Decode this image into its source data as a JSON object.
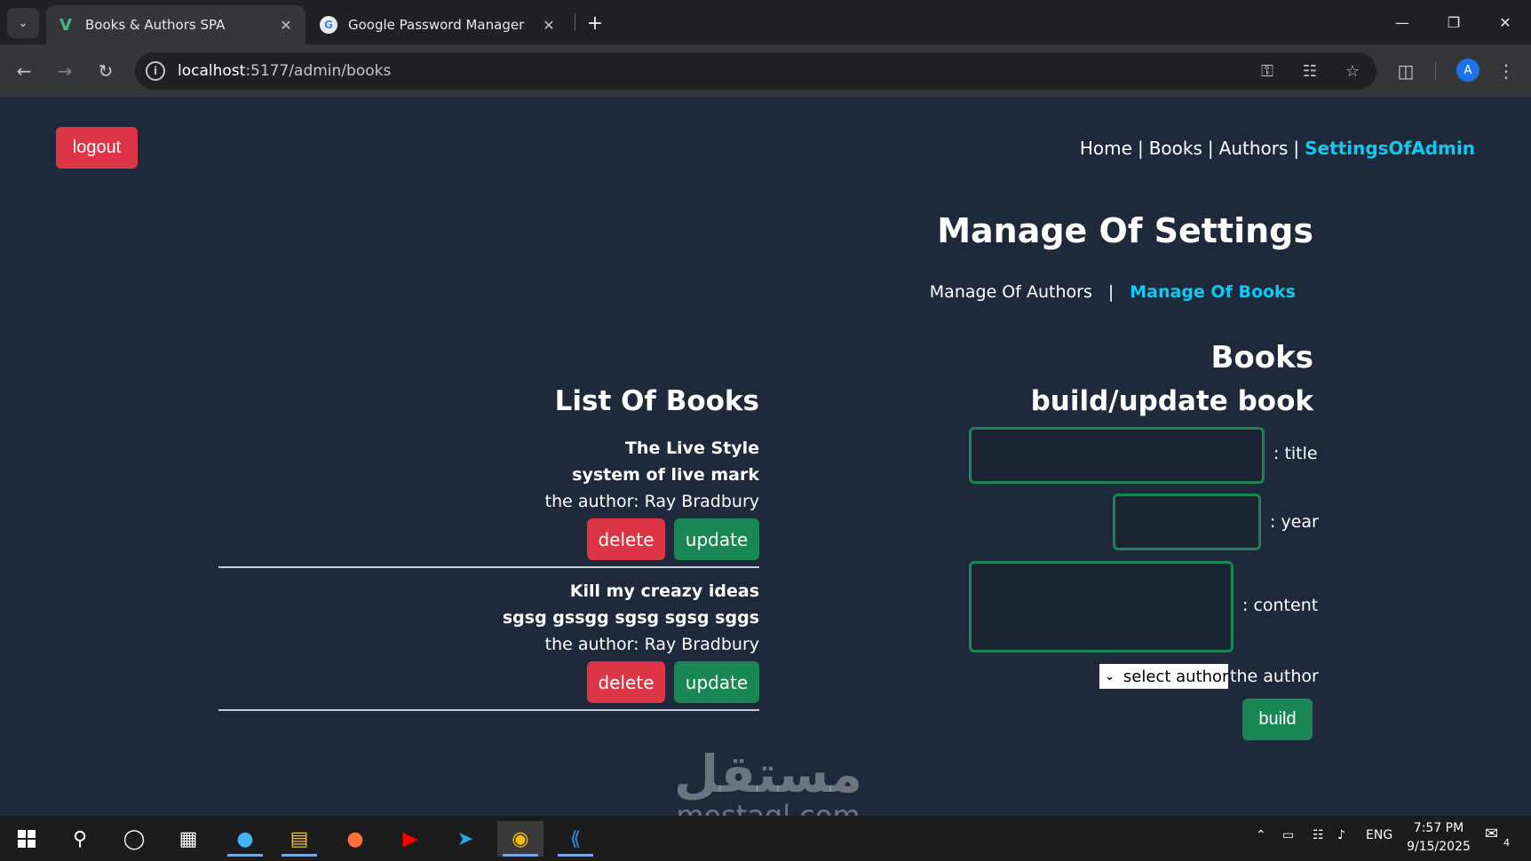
{
  "browser": {
    "tabs": [
      {
        "title": "Books & Authors SPA",
        "active": true
      },
      {
        "title": "Google Password Manager",
        "active": false
      }
    ],
    "url_host": "localhost",
    "url_rest": ":5177/admin/books",
    "avatar_letter": "A"
  },
  "page": {
    "logout_label": "logout",
    "nav": {
      "home": "Home",
      "books": "Books",
      "authors": "Authors",
      "settings": "SettingsOfAdmin",
      "separator": "|"
    },
    "settings_title": "Manage Of Settings",
    "subnav": {
      "authors": "Manage Of Authors",
      "separator": "|",
      "books": "Manage Of Books"
    },
    "books_heading": "Books",
    "form": {
      "heading": "build/update book",
      "title_label": ": title",
      "year_label": ": year",
      "content_label": ": content",
      "select_placeholder": "select author",
      "author_label": "the author",
      "build_label": "build"
    },
    "list": {
      "heading": "List Of Books",
      "books": [
        {
          "title": "The Live Style",
          "content": "system of live mark",
          "author": "the author: Ray Bradbury",
          "delete": "delete",
          "update": "update"
        },
        {
          "title": "Kill my creazy ideas",
          "content": "sgsg gssgg sgsg sgsg sggs",
          "author": "the author: Ray Bradbury",
          "delete": "delete",
          "update": "update"
        }
      ]
    }
  },
  "watermark": {
    "arabic": "مستقل",
    "latin": "mostaql.com"
  },
  "taskbar": {
    "lang": "ENG",
    "time": "7:57 PM",
    "date": "9/15/2025",
    "notifications": "4"
  }
}
